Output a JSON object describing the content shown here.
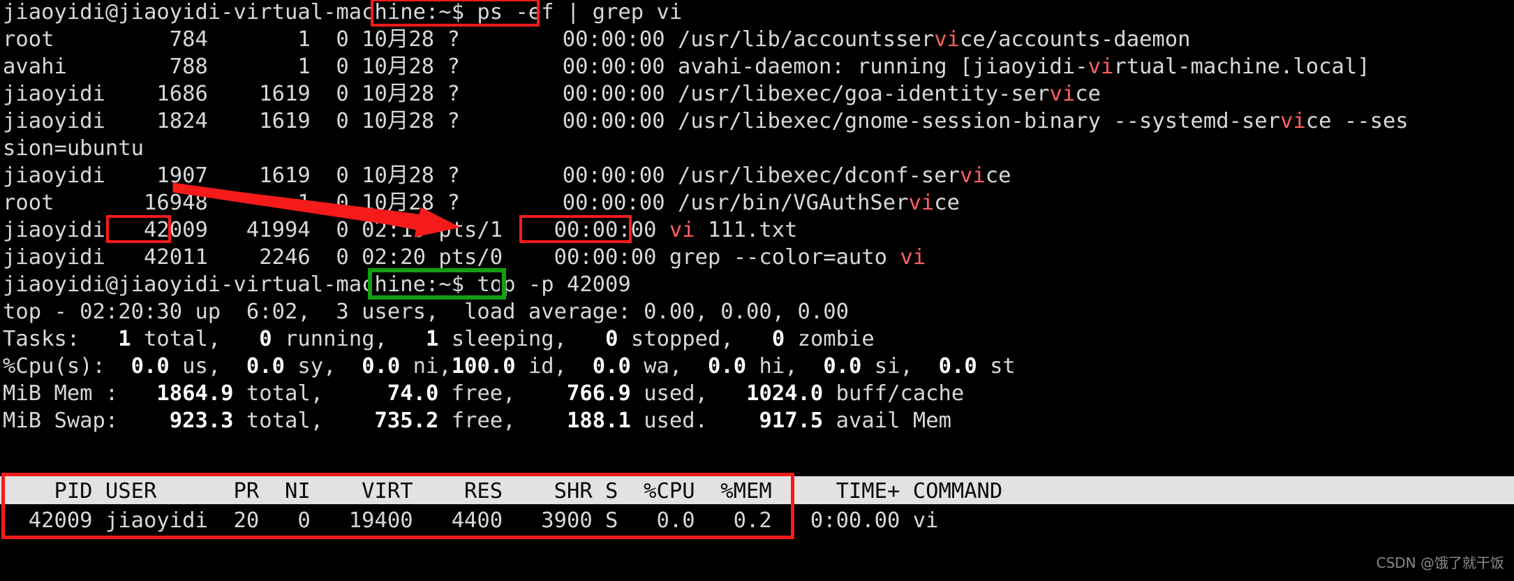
{
  "terminal": {
    "prompt": "jiaoyidi@jiaoyidi-virtual-machine:~$ ",
    "commands": {
      "ps_command": "ps -ef | grep vi",
      "top_command": "top -p 42009"
    },
    "lines": [
      {
        "id": "line-prompt-ps",
        "text": "jiaoyidi@jiaoyidi-virtual-machine:~$ ps -ef | grep vi"
      },
      {
        "id": "line-ps-1",
        "text": "root         784       1  0 10月28 ?        00:00:00 /usr/lib/accountsservice/accounts-daemon"
      },
      {
        "id": "line-ps-2",
        "text": "avahi        788       1  0 10月28 ?        00:00:00 avahi-daemon: running [jiaoyidi-virtual-machine.local]"
      },
      {
        "id": "line-ps-3",
        "text": "jiaoyidi    1686    1619  0 10月28 ?        00:00:00 /usr/libexec/goa-identity-service"
      },
      {
        "id": "line-ps-4",
        "text": "jiaoyidi    1824    1619  0 10月28 ?        00:00:00 /usr/libexec/gnome-session-binary --systemd-service --ses"
      },
      {
        "id": "line-ps-4-wrap",
        "text": "sion=ubuntu"
      },
      {
        "id": "line-ps-5",
        "text": "jiaoyidi    1907    1619  0 10月28 ?        00:00:00 /usr/libexec/dconf-service"
      },
      {
        "id": "line-ps-6",
        "text": "root       16948       1  0 10月28 ?        00:00:00 /usr/bin/VGAuthService"
      },
      {
        "id": "line-ps-7",
        "text": "jiaoyidi   42009   41994  0 02:19 pts/1    00:00:00 vi 111.txt"
      },
      {
        "id": "line-ps-8",
        "text": "jiaoyidi   42011    2246  0 02:20 pts/0    00:00:00 grep --color=auto vi"
      },
      {
        "id": "line-prompt-top",
        "text": "jiaoyidi@jiaoyidi-virtual-machine:~$ top -p 42009"
      },
      {
        "id": "line-top-summary",
        "text": "top - 02:20:30 up  6:02,  3 users,  load average: 0.00, 0.00, 0.00"
      },
      {
        "id": "line-top-tasks",
        "text": "Tasks:   1 total,   0 running,   1 sleeping,   0 stopped,   0 zombie"
      },
      {
        "id": "line-top-cpu",
        "text": "%Cpu(s):  0.0 us,  0.0 sy,  0.0 ni,100.0 id,  0.0 wa,  0.0 hi,  0.0 si,  0.0 st"
      },
      {
        "id": "line-top-mem",
        "text": "MiB Mem :   1864.9 total,     74.0 free,    766.9 used,   1024.0 buff/cache"
      },
      {
        "id": "line-top-swap",
        "text": "MiB Swap:    923.3 total,    735.2 free,    188.1 used.    917.5 avail Mem"
      }
    ],
    "ps_output": {
      "rows": [
        {
          "user": "root",
          "pid": "784",
          "ppid": "1",
          "c": "0",
          "stime": "10月28",
          "tty": "?",
          "time": "00:00:00",
          "cmd": "/usr/lib/accountsservice/accounts-daemon"
        },
        {
          "user": "avahi",
          "pid": "788",
          "ppid": "1",
          "c": "0",
          "stime": "10月28",
          "tty": "?",
          "time": "00:00:00",
          "cmd": "avahi-daemon: running [jiaoyidi-virtual-machine.local]"
        },
        {
          "user": "jiaoyidi",
          "pid": "1686",
          "ppid": "1619",
          "c": "0",
          "stime": "10月28",
          "tty": "?",
          "time": "00:00:00",
          "cmd": "/usr/libexec/goa-identity-service"
        },
        {
          "user": "jiaoyidi",
          "pid": "1824",
          "ppid": "1619",
          "c": "0",
          "stime": "10月28",
          "tty": "?",
          "time": "00:00:00",
          "cmd": "/usr/libexec/gnome-session-binary --systemd-service --session=ubuntu"
        },
        {
          "user": "jiaoyidi",
          "pid": "1907",
          "ppid": "1619",
          "c": "0",
          "stime": "10月28",
          "tty": "?",
          "time": "00:00:00",
          "cmd": "/usr/libexec/dconf-service"
        },
        {
          "user": "root",
          "pid": "16948",
          "ppid": "1",
          "c": "0",
          "stime": "10月28",
          "tty": "?",
          "time": "00:00:00",
          "cmd": "/usr/bin/VGAuthService"
        },
        {
          "user": "jiaoyidi",
          "pid": "42009",
          "ppid": "41994",
          "c": "0",
          "stime": "02:19",
          "tty": "pts/1",
          "time": "00:00:00",
          "cmd": "vi 111.txt"
        },
        {
          "user": "jiaoyidi",
          "pid": "42011",
          "ppid": "2246",
          "c": "0",
          "stime": "02:20",
          "tty": "pts/0",
          "time": "00:00:00",
          "cmd": "grep --color=auto vi"
        }
      ],
      "grep_highlight": "vi"
    },
    "top_summary": {
      "uptime_line": "top - 02:20:30 up  6:02,  3 users,  load average: 0.00, 0.00, 0.00",
      "time": "02:20:30",
      "uptime": "6:02",
      "users": "3",
      "load_average": [
        "0.00",
        "0.00",
        "0.00"
      ],
      "tasks": {
        "total": "1",
        "running": "0",
        "sleeping": "1",
        "stopped": "0",
        "zombie": "0"
      },
      "cpu": {
        "us": "0.0",
        "sy": "0.0",
        "ni": "0.0",
        "id": "100.0",
        "wa": "0.0",
        "hi": "0.0",
        "si": "0.0",
        "st": "0.0"
      },
      "mem": {
        "total": "1864.9",
        "free": "74.0",
        "used": "766.9",
        "buff_cache": "1024.0"
      },
      "swap": {
        "total": "923.3",
        "free": "735.2",
        "used": "188.1",
        "avail_mem": "917.5"
      }
    },
    "top_table": {
      "header": "    PID USER      PR  NI    VIRT    RES    SHR S  %CPU  %MEM     TIME+ COMMAND",
      "columns": [
        "PID",
        "USER",
        "PR",
        "NI",
        "VIRT",
        "RES",
        "SHR",
        "S",
        "%CPU",
        "%MEM",
        "TIME+",
        "COMMAND"
      ],
      "rows": [
        {
          "raw": "  42009 jiaoyidi  20   0   19400   4400   3900 S   0.0   0.2   0:00.00 vi",
          "pid": "42009",
          "user": "jiaoyidi",
          "pr": "20",
          "ni": "0",
          "virt": "19400",
          "res": "4400",
          "shr": "3900",
          "s": "S",
          "cpu": "0.0",
          "mem": "0.2",
          "time": "0:00.00",
          "command": "vi"
        }
      ]
    }
  },
  "annotations": {
    "red_box_ps_command": {
      "label": "ps -ef | grep vi"
    },
    "red_box_pid": {
      "label": "42009"
    },
    "red_box_vi_cmd": {
      "label": "vi 111.txt"
    },
    "green_box_top_command": {
      "label": "top -p 42009"
    },
    "red_box_top_table": {
      "label": "top result table"
    },
    "arrow": {
      "from": "42009 (ps PID column)",
      "to": "top -p 42009 (command)"
    },
    "colors": {
      "red": "#f51b1b",
      "green": "#12a012",
      "grep_highlight": "#ff5f5f",
      "terminal_bg": "#000000",
      "terminal_fg": "#d8d8d8",
      "top_header_bg": "#e2e2e2"
    }
  },
  "watermark": {
    "text": "CSDN @饿了就干饭"
  }
}
